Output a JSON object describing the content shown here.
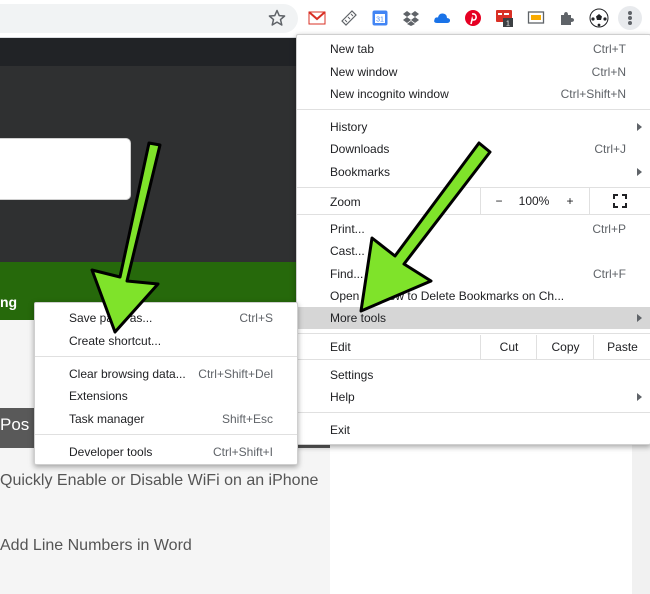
{
  "page": {
    "green_text": "ng",
    "post_label": "Pos",
    "link1": "Quickly Enable or Disable WiFi on an iPhone",
    "link2": "Add Line Numbers in Word"
  },
  "extensions": {
    "badge_count": "1",
    "icons": [
      "gmail-icon",
      "ruler-icon",
      "calendar-icon",
      "dropbox-icon",
      "cloud-icon",
      "pinterest-icon",
      "notification-icon",
      "slides-icon",
      "puzzle-icon",
      "soccer-icon"
    ],
    "calendar_day": "31"
  },
  "chrome_menu": {
    "new_tab": "New tab",
    "new_tab_sc": "Ctrl+T",
    "new_window": "New window",
    "new_window_sc": "Ctrl+N",
    "incognito": "New incognito window",
    "incognito_sc": "Ctrl+Shift+N",
    "history": "History",
    "downloads": "Downloads",
    "downloads_sc": "Ctrl+J",
    "bookmarks": "Bookmarks",
    "zoom": "Zoom",
    "zoom_minus": "−",
    "zoom_value": "100%",
    "zoom_plus": "+",
    "print": "Print...",
    "print_sc": "Ctrl+P",
    "cast": "Cast...",
    "find": "Find...",
    "find_sc": "Ctrl+F",
    "open_as": "Open in ... ow to Delete Bookmarks on Ch...",
    "more_tools": "More tools",
    "edit": "Edit",
    "cut": "Cut",
    "copy": "Copy",
    "paste": "Paste",
    "settings": "Settings",
    "help": "Help",
    "exit": "Exit"
  },
  "submenu": {
    "save_page": "Save page as...",
    "save_page_sc": "Ctrl+S",
    "create_shortcut": "Create shortcut...",
    "clear_data": "Clear browsing data...",
    "clear_data_sc": "Ctrl+Shift+Del",
    "extensions": "Extensions",
    "task_manager": "Task manager",
    "task_manager_sc": "Shift+Esc",
    "dev_tools": "Developer tools",
    "dev_tools_sc": "Ctrl+Shift+I"
  },
  "colors": {
    "arrow_fill": "#7fe32a",
    "arrow_stroke": "#000000",
    "highlight": "#d6d6d6",
    "green_bar": "#26690b"
  }
}
